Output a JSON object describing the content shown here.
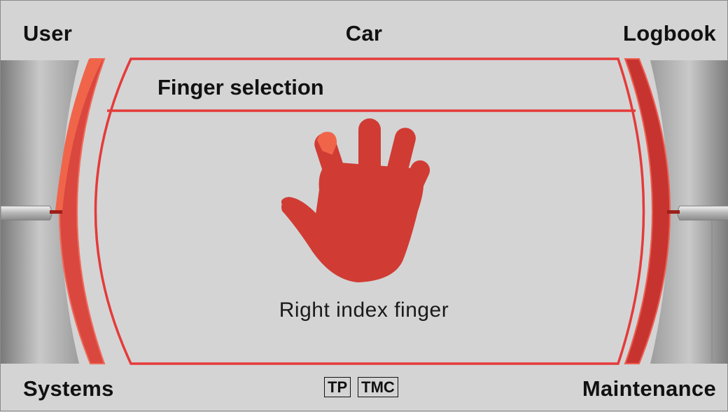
{
  "corners": {
    "top_left": "User",
    "top_center": "Car",
    "top_right": "Logbook",
    "bottom_left": "Systems",
    "bottom_right": "Maintenance"
  },
  "status_badges": [
    "TP",
    "TMC"
  ],
  "menu": {
    "title": "Finger selection",
    "selection_caption": "Right index finger"
  },
  "icons": {
    "hand": "right-hand-icon",
    "highlighted_finger": "index-finger"
  },
  "colors": {
    "accent_red": "#e53a3a",
    "hand_red": "#d03c34",
    "highlight_orange": "#f0654a",
    "background": "#d4d4d4"
  }
}
